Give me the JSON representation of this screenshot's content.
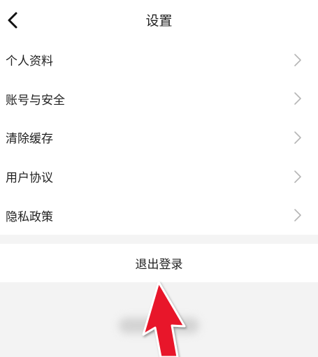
{
  "header": {
    "title": "设置",
    "back_icon": "chevron-left-icon"
  },
  "settings": {
    "items": [
      {
        "label": "个人资料",
        "icon": "chevron-right-icon"
      },
      {
        "label": "账号与安全",
        "icon": "chevron-right-icon"
      },
      {
        "label": "清除缓存",
        "icon": "chevron-right-icon"
      },
      {
        "label": "用户协议",
        "icon": "chevron-right-icon"
      },
      {
        "label": "隐私政策",
        "icon": "chevron-right-icon"
      }
    ]
  },
  "logout": {
    "label": "退出登录"
  },
  "annotation": {
    "icon": "red-arrow-pointer",
    "color": "#e8192c"
  },
  "colors": {
    "background": "#f4f4f4",
    "card": "#ffffff",
    "text": "#222222",
    "chevron": "#b5b5b5",
    "arrow": "#e8192c"
  }
}
